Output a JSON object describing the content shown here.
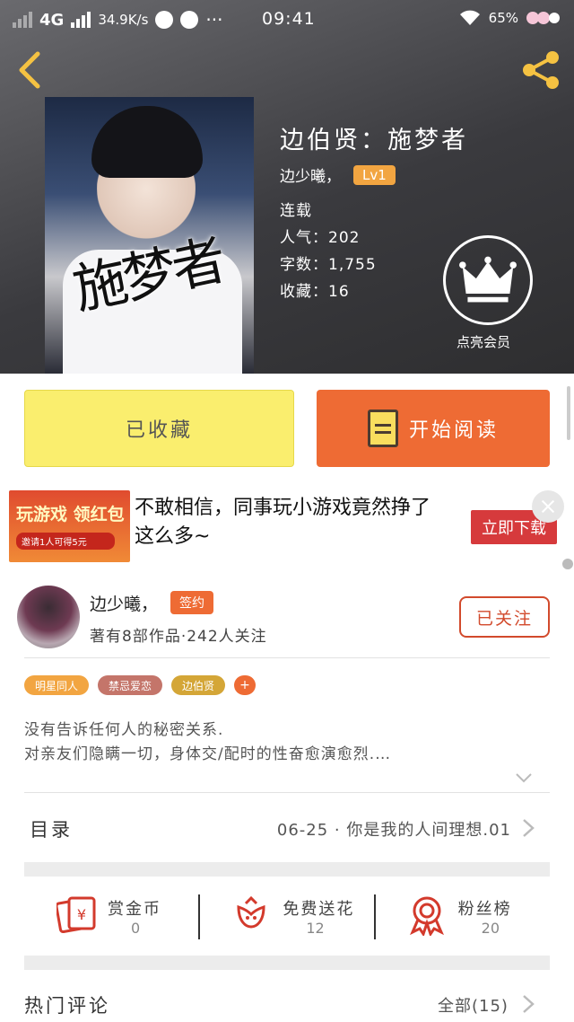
{
  "status_bar": {
    "network": "4G",
    "speed": "34.9K/s",
    "dots": "···",
    "time": "09:41",
    "battery": "65%"
  },
  "book": {
    "title": "边伯贤：施梦者",
    "author": "边少曦，",
    "level": "Lv1",
    "status": "连载",
    "popularity": "人气：202",
    "word_count": "字数：1,755",
    "favorites": "收藏：16",
    "vip_label": "点亮会员",
    "cover_title": "施梦者"
  },
  "actions": {
    "collected_label": "已收藏",
    "read_label": "开始阅读"
  },
  "ad": {
    "image_title": "玩游戏 领红包",
    "image_sub": "邀请1人可得5元",
    "text": "不敢相信，同事玩小游戏竟然挣了这么多~",
    "button": "立即下载"
  },
  "author_card": {
    "name": "边少曦，",
    "badge": "签约",
    "stats": "著有8部作品·242人关注",
    "follow_label": "已关注"
  },
  "tags": [
    {
      "label": "明星同人",
      "color": "#f2a541"
    },
    {
      "label": "禁忌爱恋",
      "color": "#c4756a"
    },
    {
      "label": "边伯贤",
      "color": "#d4a637"
    }
  ],
  "tag_add": "+",
  "description": {
    "line1": "没有告诉任何人的秘密关系.",
    "line2": "对亲友们隐瞒一切，身体交/配时的性奋愈演愈烈.…"
  },
  "toc": {
    "label": "目录",
    "latest": "06-25 · 你是我的人间理想.01"
  },
  "rewards": [
    {
      "label": "赏金币",
      "value": "0"
    },
    {
      "label": "免费送花",
      "value": "12"
    },
    {
      "label": "粉丝榜",
      "value": "20"
    }
  ],
  "hot_comments": {
    "label": "热门评论",
    "all": "全部(15)"
  },
  "colors": {
    "accent": "#ee6b34",
    "collected_bg": "#faee6e",
    "follow_border": "#d24a2c"
  }
}
